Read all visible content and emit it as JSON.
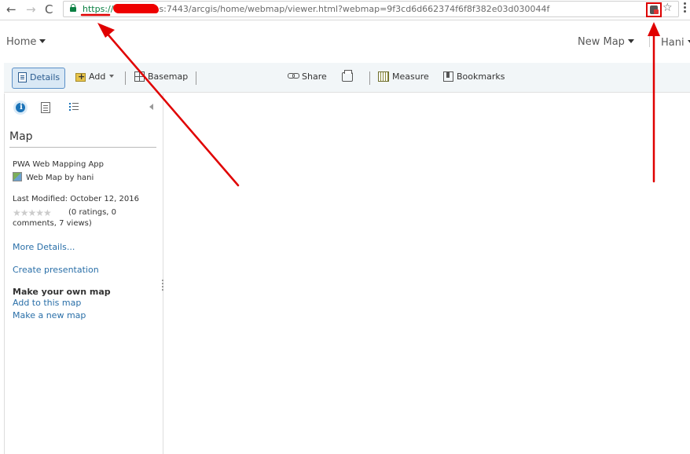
{
  "browser": {
    "url_scheme": "https://",
    "url_rest": "s:7443/arcgis/home/webmap/viewer.html?webmap=9f3cd6d662374f6f8f382e03d030044f",
    "back_glyph": "←",
    "forward_glyph": "→",
    "reload_glyph": "C",
    "star_glyph": "☆",
    "icons": [
      "back-icon",
      "forward-icon",
      "reload-icon",
      "lock-icon",
      "extension-icon",
      "star-icon",
      "menu-icon"
    ]
  },
  "header": {
    "home_label": "Home",
    "new_map_label": "New Map",
    "user_label": "Hani"
  },
  "toolbar": {
    "details_label": "Details",
    "add_label": "Add",
    "basemap_label": "Basemap",
    "share_label": "Share",
    "measure_label": "Measure",
    "bookmarks_label": "Bookmarks"
  },
  "panel": {
    "title": "Map",
    "app_title": "PWA Web Mapping App",
    "owner": "Web Map by hani",
    "last_modified": "Last Modified: October 12, 2016",
    "stars": "★★★★★",
    "rating_count": 0,
    "ratings_text_1": "(0 ratings, 0",
    "ratings_text_2": "comments, 7 views)",
    "more_details": "More Details...",
    "create_presentation": "Create presentation",
    "make_own_heading": "Make your own map",
    "add_to_map": "Add to this map",
    "make_new_map": "Make a new map",
    "info_glyph": "i"
  },
  "colors": {
    "annotation": "#e00000",
    "link": "#2a6fa8",
    "secure_green": "#0b8043",
    "toolbar_bg": "#f2f6f8"
  }
}
